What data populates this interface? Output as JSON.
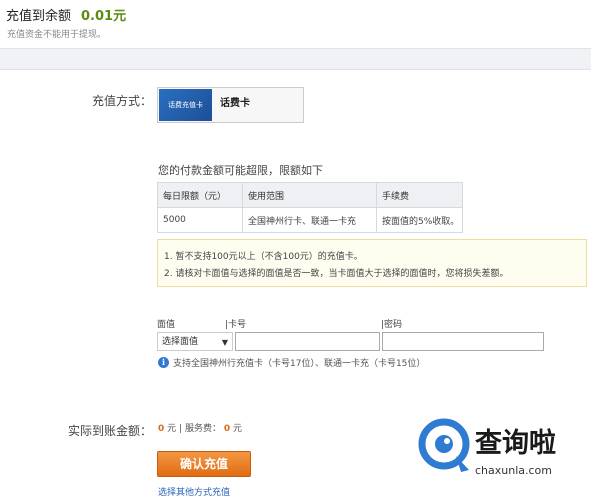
{
  "header": {
    "title": "充值到余额",
    "amount": "0.01元",
    "note": "充值资金不能用于提现。"
  },
  "method": {
    "label": "充值方式：",
    "card_image_text": "话费充值卡",
    "card_name": "话费卡"
  },
  "limits": {
    "heading": "您的付款金额可能超限，限额如下",
    "columns": [
      "每日限额（元）",
      "使用范围",
      "手续费"
    ],
    "rows": [
      [
        "5000",
        "全国神州行卡、联通一卡充",
        "按面值的5%收取。"
      ]
    ]
  },
  "notices": [
    "1.    暂不支持100元以上（不含100元）的充值卡。",
    "2.    请核对卡面值与选择的面值是否一致，当卡面值大于选择的面值时，您将损失差额。"
  ],
  "form": {
    "face_value_label": "面值",
    "card_no_label": "|卡号",
    "password_label": "|密码",
    "select_value": "选择面值",
    "support_text": "支持全国神州行充值卡（卡号17位）、联通一卡充（卡号15位）"
  },
  "amount": {
    "label": "实际到账金额：",
    "value": "0",
    "unit1": "元",
    "service_label": "服务费：",
    "fee": "0",
    "unit2": "元"
  },
  "buttons": {
    "confirm": "确认充值",
    "other_methods": "选择其他方式充值"
  },
  "watermark": {
    "cn": "查询啦",
    "en": "chaxunla.com"
  },
  "colors": {
    "accent_orange": "#e0671a",
    "amount_green": "#5a8a10",
    "link_blue": "#2a63b8",
    "watermark_blue": "#2f7bd2"
  }
}
